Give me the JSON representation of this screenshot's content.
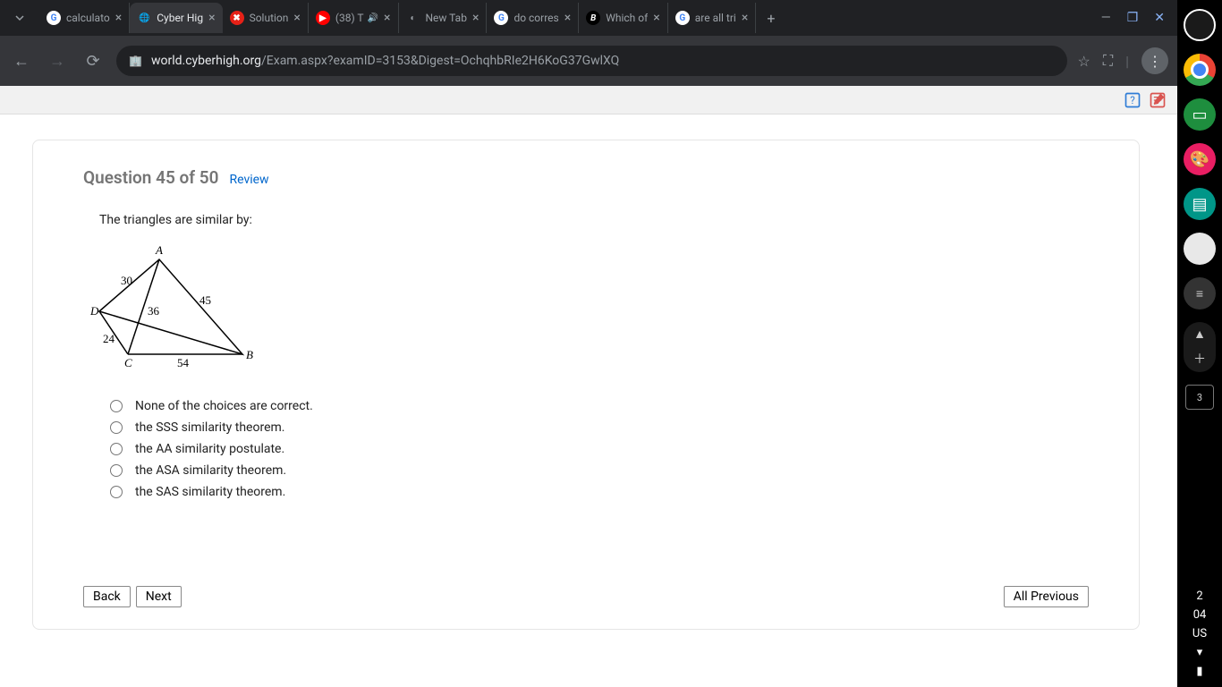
{
  "browser": {
    "tabs": [
      {
        "title": "calculato",
        "favicon": "G",
        "favicon_bg": "#fff",
        "favicon_color": "#4285f4"
      },
      {
        "title": "Cyber Hig",
        "favicon": "🌐",
        "favicon_bg": "#35363a",
        "active": true
      },
      {
        "title": "Solution",
        "favicon": "✖",
        "favicon_bg": "#e62117",
        "favicon_color": "#fff"
      },
      {
        "title": "(38) T",
        "favicon": "▶",
        "favicon_bg": "#ff0000",
        "favicon_color": "#fff",
        "audio": true
      },
      {
        "title": "New Tab",
        "favicon": "◐",
        "favicon_bg": "transparent",
        "favicon_color": "#9aa0a6"
      },
      {
        "title": "do corres",
        "favicon": "G",
        "favicon_bg": "#fff",
        "favicon_color": "#4285f4"
      },
      {
        "title": "Which of",
        "favicon": "B",
        "favicon_bg": "#000",
        "favicon_color": "#fff"
      },
      {
        "title": "are all tri",
        "favicon": "G",
        "favicon_bg": "#fff",
        "favicon_color": "#4285f4"
      }
    ],
    "url_host": "world.cyberhigh.org",
    "url_path": "/Exam.aspx?examID=3153&Digest=OchqhbRIe2H6KoG37GwlXQ"
  },
  "exam": {
    "question_label": "Question 45 of 50",
    "review_label": "Review",
    "prompt": "The triangles are similar by:",
    "figure": {
      "labels": {
        "A": "A",
        "B": "B",
        "C": "C",
        "D": "D"
      },
      "sides": {
        "DA": "30",
        "AB": "45",
        "DC": "24",
        "CB": "54",
        "AC": "36"
      }
    },
    "choices": [
      "None of the choices are correct.",
      "the SSS similarity theorem.",
      "the AA similarity postulate.",
      "the ASA similarity theorem.",
      "the SAS similarity theorem."
    ],
    "buttons": {
      "back": "Back",
      "next": "Next",
      "all_previous": "All Previous"
    }
  },
  "shelf": {
    "time1": "2",
    "time2": "04",
    "locale": "US",
    "tab_count": "3"
  }
}
